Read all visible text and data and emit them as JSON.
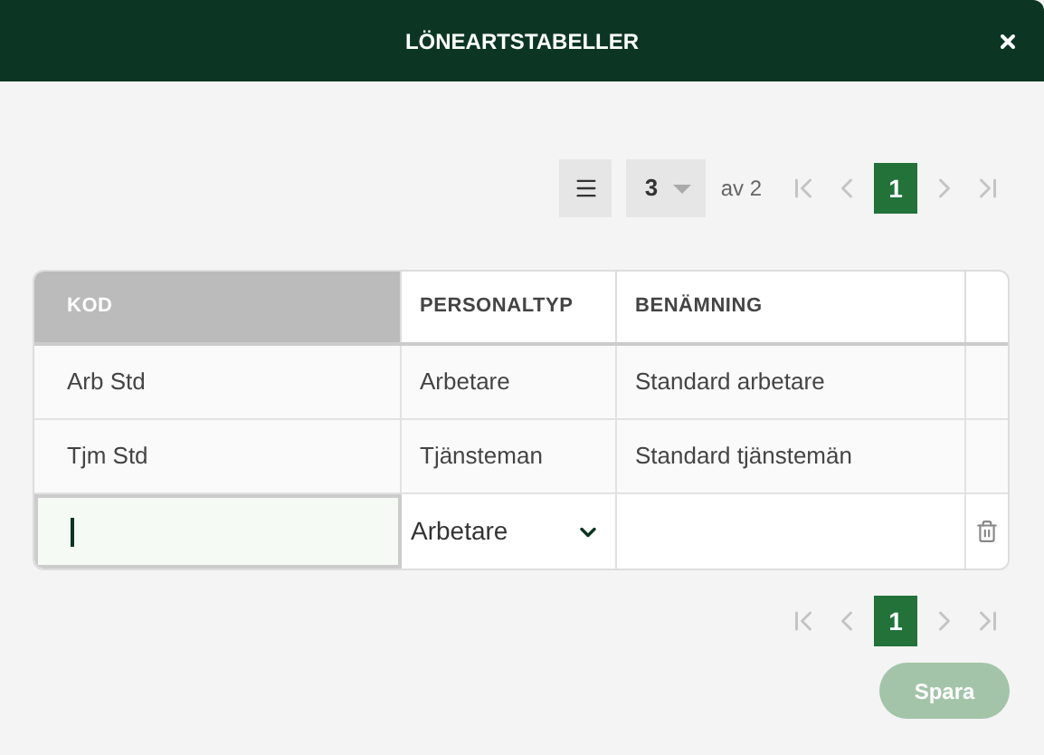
{
  "window": {
    "title": "LÖNEARTSTABELLER"
  },
  "top_pager": {
    "page_size": "3",
    "page_count": "av 2",
    "pages": [
      {
        "label": "1",
        "selected": true
      }
    ]
  },
  "table": {
    "columns": [
      {
        "label": "KOD",
        "sorted": true
      },
      {
        "label": "PERSONALTYP",
        "sorted": false
      },
      {
        "label": "BENÄMNING",
        "sorted": false
      }
    ],
    "rows": [
      [
        "Arb Std",
        "Arbetare",
        "Standard arbetare"
      ],
      [
        "Tjm Std",
        "Tjänsteman",
        "Standard tjänstemän"
      ]
    ],
    "new_row": {
      "personaltyp": "Arbetare"
    }
  },
  "bottom_pager": {
    "pages": [
      {
        "label": "1",
        "selected": true
      }
    ]
  },
  "save_button": {
    "label": "Spara",
    "disabled": true
  }
}
